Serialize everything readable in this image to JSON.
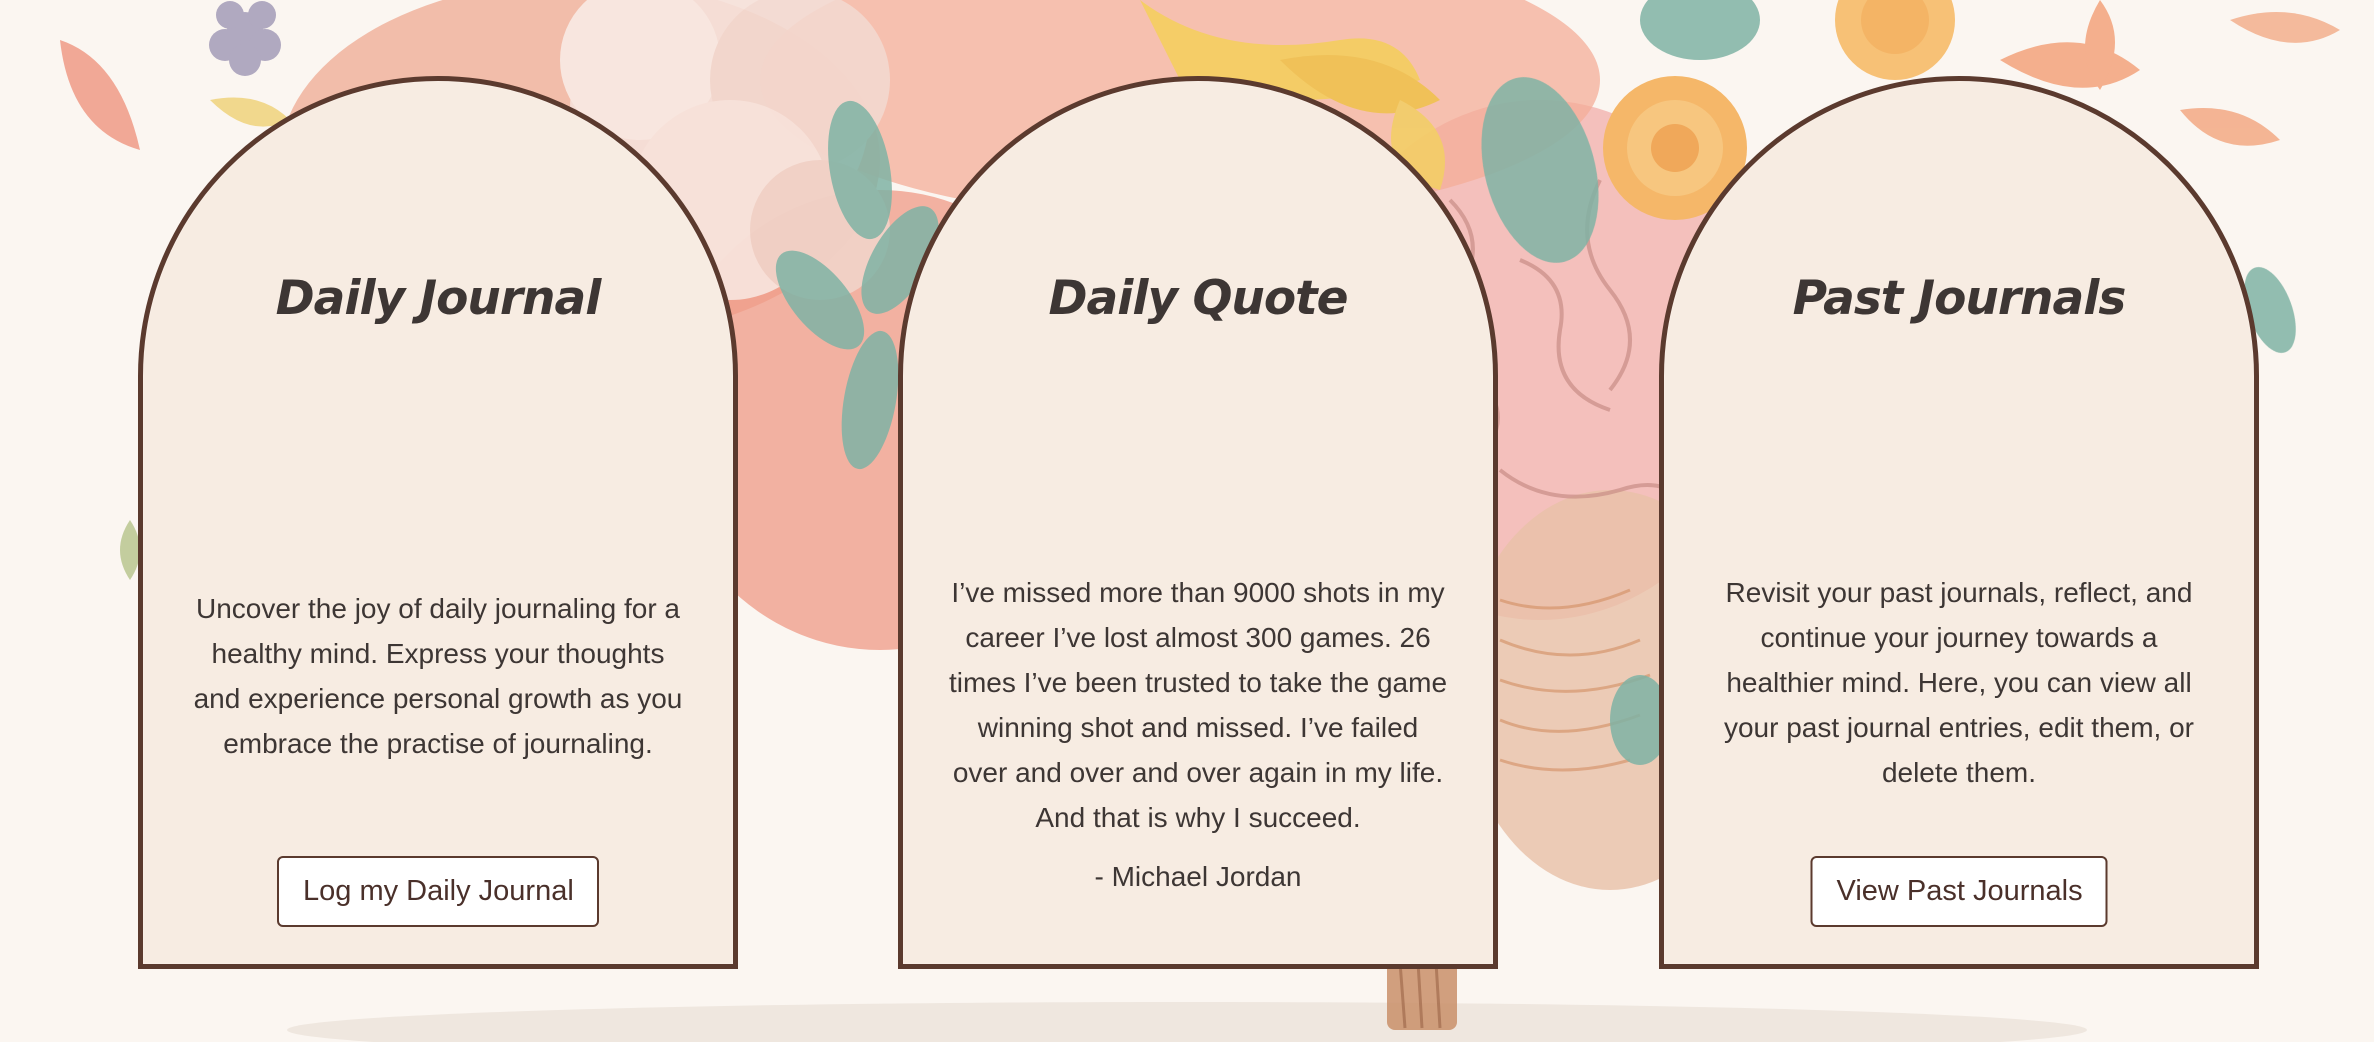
{
  "cards": [
    {
      "title": "Daily Journal",
      "description": "Uncover the joy of daily journaling for a healthy mind. Express your thoughts and experience personal growth as you embrace the practise of journaling.",
      "button_label": "Log my Daily Journal"
    },
    {
      "title": "Daily Quote",
      "quote": "I’ve missed more than 9000 shots in my career I’ve lost almost 300 games. 26 times I’ve been trusted to take the game winning shot and missed. I’ve failed over and over and over again in my life. And that is why I succeed.",
      "author": "- Michael Jordan"
    },
    {
      "title": "Past Journals",
      "description": "Revisit your past journals, reflect, and continue your journey towards a healthier mind. Here, you can view all your past journal entries, edit them, or delete them.",
      "button_label": "View Past Journals"
    }
  ],
  "colors": {
    "card_background": "#f7ece2",
    "card_border": "#5b3a2e",
    "text": "#3d3634",
    "page_background": "#fbf6f1"
  },
  "background": {
    "illustration": "flower-brain-illustration"
  }
}
